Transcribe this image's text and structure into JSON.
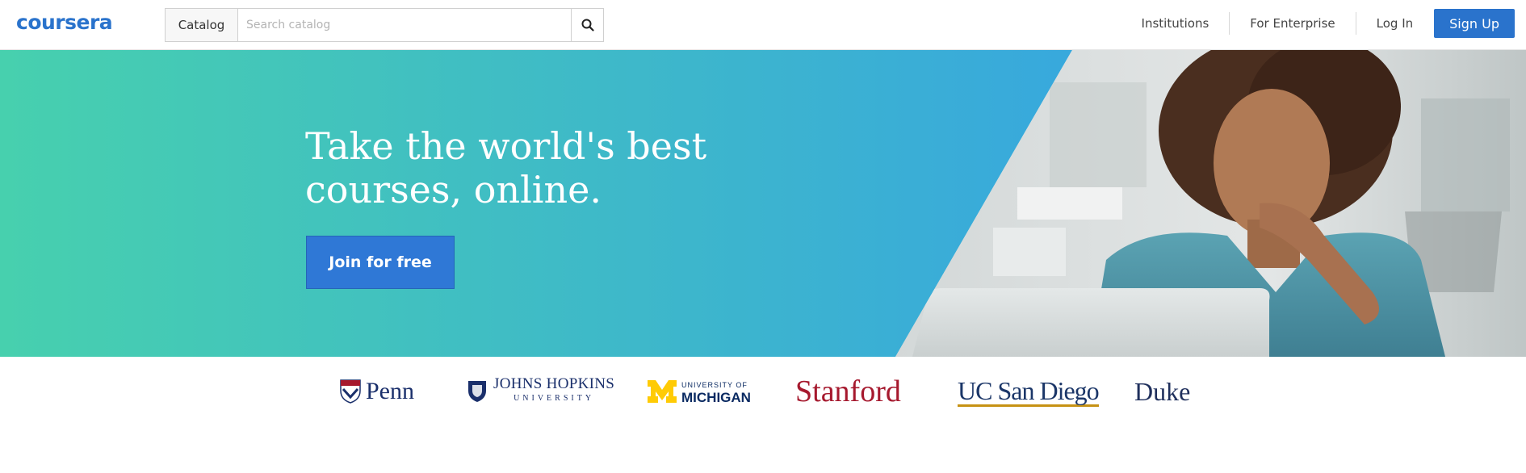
{
  "header": {
    "logo_text": "coursera",
    "catalog_label": "Catalog",
    "search_placeholder": "Search catalog",
    "nav": {
      "institutions": "Institutions",
      "enterprise": "For Enterprise",
      "login": "Log In",
      "signup": "Sign Up"
    }
  },
  "hero": {
    "title": "Take the world's best courses, online.",
    "cta": "Join for free",
    "image_desc": "woman-at-laptop-photo"
  },
  "partners": {
    "penn": "Penn",
    "jhu_main": "JOHNS HOPKINS",
    "jhu_sub": "UNIVERSITY",
    "michigan_top": "UNIVERSITY OF",
    "michigan_main": "MICHIGAN",
    "stanford": "Stanford",
    "ucsd": "UC San Diego",
    "duke": "Duke"
  },
  "colors": {
    "brand_blue": "#2a73cc",
    "hero_start": "#47d0ae",
    "hero_end": "#37a6e0",
    "stanford_red": "#a6192e",
    "michigan_maize": "#ffcb05"
  }
}
